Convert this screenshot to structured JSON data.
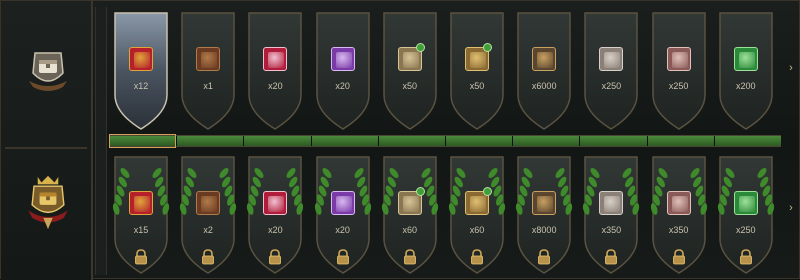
{
  "free_track": {
    "items": [
      {
        "icon": "red-gift-chest-icon",
        "qty": "x12",
        "color": "#b5202a",
        "accent": "#e0a43a",
        "current": true
      },
      {
        "icon": "brown-book-icon",
        "qty": "x1",
        "color": "#6b3a22",
        "accent": "#b07a4a"
      },
      {
        "icon": "red-star-book-icon",
        "qty": "x20",
        "color": "#b01c3a",
        "accent": "#f0c0d0"
      },
      {
        "icon": "purple-crystal-book-icon",
        "qty": "x20",
        "color": "#7a3aa8",
        "accent": "#d8b8f0"
      },
      {
        "icon": "scroll-map-icon",
        "qty": "x50",
        "color": "#8a7650",
        "accent": "#d6c498",
        "badge": true
      },
      {
        "icon": "speedup-scroll-icon",
        "qty": "x50",
        "color": "#8a6a32",
        "accent": "#e0c070",
        "badge": true
      },
      {
        "icon": "resource-bundle-icon",
        "qty": "x6000",
        "color": "#5a4630",
        "accent": "#c8a060"
      },
      {
        "icon": "stone-ore-icon",
        "qty": "x250",
        "color": "#8a8078",
        "accent": "#d8d0c8"
      },
      {
        "icon": "pink-egg-icon",
        "qty": "x250",
        "color": "#8a5a58",
        "accent": "#e0c0b8"
      },
      {
        "icon": "green-clover-token-icon",
        "qty": "x200",
        "color": "#2a8a3a",
        "accent": "#9ee09a"
      }
    ]
  },
  "premium_track": {
    "items": [
      {
        "icon": "red-gift-chest-icon",
        "qty": "x15",
        "color": "#b5202a",
        "accent": "#e0a43a"
      },
      {
        "icon": "brown-book-icon",
        "qty": "x2",
        "color": "#6b3a22",
        "accent": "#b07a4a"
      },
      {
        "icon": "red-star-book-icon",
        "qty": "x20",
        "color": "#b01c3a",
        "accent": "#f0c0d0"
      },
      {
        "icon": "purple-crystal-book-icon",
        "qty": "x20",
        "color": "#7a3aa8",
        "accent": "#d8b8f0"
      },
      {
        "icon": "scroll-map-icon",
        "qty": "x60",
        "color": "#8a7650",
        "accent": "#d6c498",
        "badge": true
      },
      {
        "icon": "speedup-scroll-icon",
        "qty": "x60",
        "color": "#8a6a32",
        "accent": "#e0c070",
        "badge": true
      },
      {
        "icon": "resource-bundle-icon",
        "qty": "x8000",
        "color": "#5a4630",
        "accent": "#c8a060"
      },
      {
        "icon": "stone-ore-icon",
        "qty": "x350",
        "color": "#8a8078",
        "accent": "#d8d0c8"
      },
      {
        "icon": "pink-egg-icon",
        "qty": "x350",
        "color": "#8a5a58",
        "accent": "#e0c0b8"
      },
      {
        "icon": "green-clover-token-icon",
        "qty": "x250",
        "color": "#2a8a3a",
        "accent": "#9ee09a"
      }
    ]
  },
  "progress": {
    "filled_fraction": 1.0,
    "current_level": 1,
    "level_count": 10
  },
  "colors": {
    "gold": "#c9a55a",
    "laurel": "#3f8a2a",
    "progress_green": "#3e7a30",
    "panel": "#1b201e"
  }
}
